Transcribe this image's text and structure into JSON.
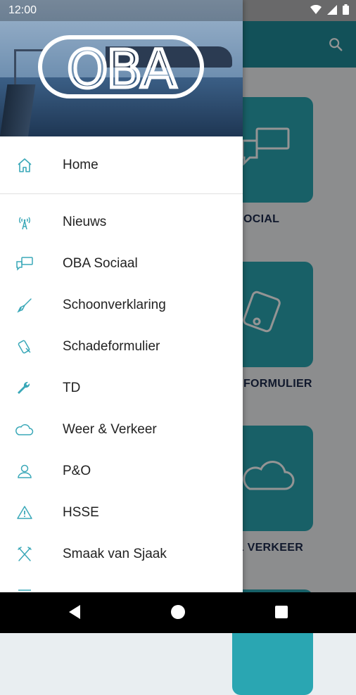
{
  "status_bar": {
    "time": "12:00"
  },
  "drawer": {
    "brand": "OBA",
    "items": [
      {
        "label": "Home",
        "icon": "home-icon"
      },
      {
        "label": "Nieuws",
        "icon": "broadcast-tower-icon"
      },
      {
        "label": "OBA Sociaal",
        "icon": "chat-bubbles-icon"
      },
      {
        "label": "Schoonverklaring",
        "icon": "broom-icon"
      },
      {
        "label": "Schadeformulier",
        "icon": "damage-icon"
      },
      {
        "label": "TD",
        "icon": "wrench-icon"
      },
      {
        "label": "Weer & Verkeer",
        "icon": "cloud-icon"
      },
      {
        "label": "P&O",
        "icon": "person-icon"
      },
      {
        "label": "HSSE",
        "icon": "warning-icon"
      },
      {
        "label": "Smaak van Sjaak",
        "icon": "cutlery-icon"
      }
    ]
  },
  "background": {
    "tiles": [
      {
        "label": "SOCIAL"
      },
      {
        "label": "EFORMULIER"
      },
      {
        "label": "& VERKEER"
      }
    ]
  },
  "colors": {
    "accent": "#2aa6b2",
    "appbar": "#1f8c99",
    "icon": "#3aa8b8"
  }
}
